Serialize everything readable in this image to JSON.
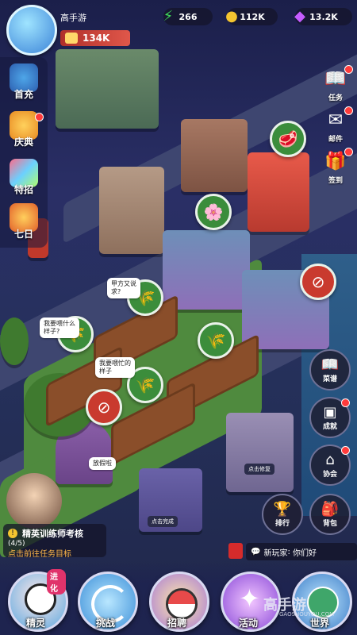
{
  "player": {
    "name": "高手游",
    "power": "134K"
  },
  "resources": [
    {
      "name": "energy",
      "icon": "lightning-icon",
      "value": "266",
      "color": "#3fdc5a"
    },
    {
      "name": "coins",
      "icon": "coin-icon",
      "value": "112K",
      "color": "#f4c430"
    },
    {
      "name": "gems",
      "icon": "gem-icon",
      "value": "13.2K",
      "color": "#c45cff"
    }
  ],
  "left_menu": [
    {
      "label": "首充",
      "icon": "bird-icon"
    },
    {
      "label": "庆典",
      "icon": "celebration-icon"
    },
    {
      "label": "特招",
      "icon": "recruit-card-icon"
    },
    {
      "label": "七日",
      "icon": "seven-day-gift-icon"
    }
  ],
  "right_menu": [
    {
      "label": "任务",
      "icon": "quest-book-icon"
    },
    {
      "label": "邮件",
      "icon": "mail-icon"
    },
    {
      "label": "签到",
      "icon": "gift-icon"
    }
  ],
  "right_buttons": [
    {
      "label": "菜谱",
      "icon": "recipe-book-icon"
    },
    {
      "label": "成就",
      "icon": "achievement-icon"
    },
    {
      "label": "协会",
      "icon": "guild-icon"
    },
    {
      "label": "排行",
      "icon": "trophy-icon"
    },
    {
      "label": "背包",
      "icon": "backpack-icon"
    }
  ],
  "map_notes": {
    "note1": "甲方又说\n求?",
    "note2": "我要喂什么\n样子?",
    "note3": "我要喂忙的\n样子",
    "note4": "放假啦",
    "tag1": "点击修复",
    "tag2": "点击完成"
  },
  "quest": {
    "title": "精英训练师考核",
    "progress": "(4/5)",
    "link": "点击前往任务目标"
  },
  "chat": {
    "speaker": "新玩家",
    "text": "你们好"
  },
  "bottom_nav": [
    {
      "label": "精灵",
      "badge": "进化"
    },
    {
      "label": "挑战"
    },
    {
      "label": "招聘"
    },
    {
      "label": "活动"
    },
    {
      "label": "世界"
    }
  ],
  "watermark": {
    "brand": "高手游",
    "site": "GAOSHOUYOU.COM"
  }
}
